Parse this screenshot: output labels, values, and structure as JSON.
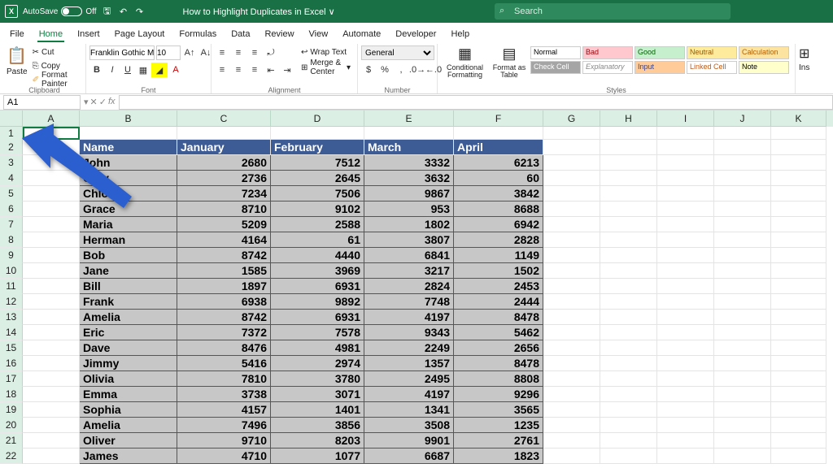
{
  "title": {
    "autosave": "AutoSave",
    "autosave_state": "Off",
    "filename": "How to Highlight Duplicates in Excel ∨",
    "search_ph": "Search"
  },
  "menu": {
    "file": "File",
    "home": "Home",
    "insert": "Insert",
    "page": "Page Layout",
    "formulas": "Formulas",
    "data": "Data",
    "review": "Review",
    "view": "View",
    "automate": "Automate",
    "developer": "Developer",
    "help": "Help"
  },
  "ribbon": {
    "clipboard": {
      "paste": "Paste",
      "cut": "Cut",
      "copy": "Copy",
      "fmt": "Format Painter",
      "label": "Clipboard"
    },
    "font": {
      "name": "Franklin Gothic Me",
      "size": "10",
      "label": "Font"
    },
    "align": {
      "wrap": "Wrap Text",
      "merge": "Merge & Center",
      "label": "Alignment"
    },
    "number": {
      "fmt": "General",
      "label": "Number"
    },
    "styles": {
      "cond": "Conditional\nFormatting",
      "fas": "Format as\nTable",
      "normal": "Normal",
      "bad": "Bad",
      "good": "Good",
      "neutral": "Neutral",
      "calc": "Calculation",
      "check": "Check Cell",
      "exp": "Explanatory ...",
      "input": "Input",
      "linked": "Linked Cell",
      "note": "Note",
      "label": "Styles"
    },
    "cells": {
      "ins": "Ins"
    }
  },
  "fbar": {
    "namebox": "A1"
  },
  "cols": [
    "A",
    "B",
    "C",
    "D",
    "E",
    "F",
    "G",
    "H",
    "I",
    "J",
    "K"
  ],
  "rows_shown": 22,
  "headers": {
    "b": "Name",
    "c": "January",
    "d": "February",
    "e": "March",
    "f": "April"
  },
  "data": [
    {
      "name": "John",
      "jan": 2680,
      "feb": 7512,
      "mar": 3332,
      "apr": 6213
    },
    {
      "name": "Gary",
      "jan": 2736,
      "feb": 2645,
      "mar": 3632,
      "apr": 60
    },
    {
      "name": "Chloe",
      "jan": 7234,
      "feb": 7506,
      "mar": 9867,
      "apr": 3842
    },
    {
      "name": "Grace",
      "jan": 8710,
      "feb": 9102,
      "mar": 953,
      "apr": 8688
    },
    {
      "name": "Maria",
      "jan": 5209,
      "feb": 2588,
      "mar": 1802,
      "apr": 6942
    },
    {
      "name": "Herman",
      "jan": 4164,
      "feb": 61,
      "mar": 3807,
      "apr": 2828
    },
    {
      "name": "Bob",
      "jan": 8742,
      "feb": 4440,
      "mar": 6841,
      "apr": 1149
    },
    {
      "name": "Jane",
      "jan": 1585,
      "feb": 3969,
      "mar": 3217,
      "apr": 1502
    },
    {
      "name": "Bill",
      "jan": 1897,
      "feb": 6931,
      "mar": 2824,
      "apr": 2453
    },
    {
      "name": "Frank",
      "jan": 6938,
      "feb": 9892,
      "mar": 7748,
      "apr": 2444
    },
    {
      "name": "Amelia",
      "jan": 8742,
      "feb": 6931,
      "mar": 4197,
      "apr": 8478
    },
    {
      "name": "Eric",
      "jan": 7372,
      "feb": 7578,
      "mar": 9343,
      "apr": 5462
    },
    {
      "name": "Dave",
      "jan": 8476,
      "feb": 4981,
      "mar": 2249,
      "apr": 2656
    },
    {
      "name": "Jimmy",
      "jan": 5416,
      "feb": 2974,
      "mar": 1357,
      "apr": 8478
    },
    {
      "name": "Olivia",
      "jan": 7810,
      "feb": 3780,
      "mar": 2495,
      "apr": 8808
    },
    {
      "name": "Emma",
      "jan": 3738,
      "feb": 3071,
      "mar": 4197,
      "apr": 9296
    },
    {
      "name": "Sophia",
      "jan": 4157,
      "feb": 1401,
      "mar": 1341,
      "apr": 3565
    },
    {
      "name": "Amelia",
      "jan": 7496,
      "feb": 3856,
      "mar": 3508,
      "apr": 1235
    },
    {
      "name": "Oliver",
      "jan": 9710,
      "feb": 8203,
      "mar": 9901,
      "apr": 2761
    },
    {
      "name": "James",
      "jan": 4710,
      "feb": 1077,
      "mar": 6687,
      "apr": 1823
    }
  ]
}
